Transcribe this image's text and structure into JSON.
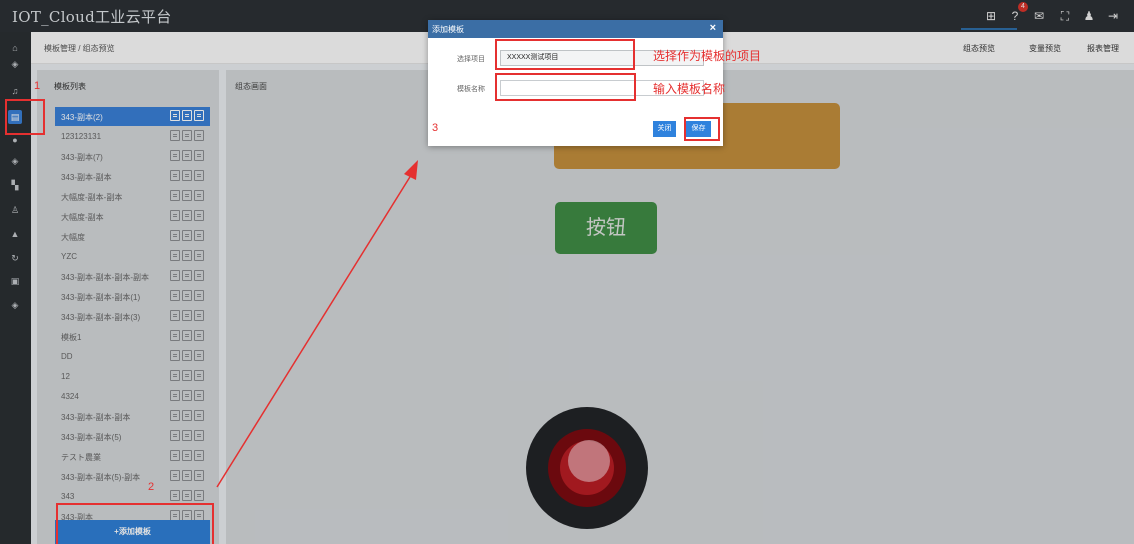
{
  "app": {
    "title": "IOT_Cloud工业云平台"
  },
  "topbar": {
    "icons": [
      "apps-icon",
      "help-icon",
      "mail-icon",
      "fullscreen-icon",
      "user-icon",
      "logout-icon"
    ],
    "notification_count": "4"
  },
  "breadcrumb": "模板管理 / 组态预览",
  "right_tabs": [
    "组态预览",
    "变量预览",
    "报表管理"
  ],
  "sidebar": {
    "icons": [
      "home-icon",
      "layers-icon",
      "bell-icon",
      "template-icon",
      "car-icon",
      "layers2-icon",
      "grid-icon",
      "user-icon",
      "cap-icon",
      "refresh-icon",
      "list-icon",
      "layers3-icon"
    ]
  },
  "left_panel": {
    "title": "模板列表",
    "items": [
      "343-副本(2)",
      "123123131",
      "343-副本(7)",
      "343-副本-副本",
      "大幅度-副本-副本",
      "大幅度-副本",
      "大幅度",
      "YZC",
      "343-副本-副本-副本-副本",
      "343-副本-副本-副本(1)",
      "343-副本-副本-副本(3)",
      "模板1",
      "DD",
      "12",
      "4324",
      "343-副本-副本-副本",
      "343-副本-副本(5)",
      "テスト農業",
      "343-副本-副本(5)-副本",
      "343",
      "343-副本"
    ],
    "add_button": "+添加模板"
  },
  "canvas": {
    "title": "组态画面",
    "button_label": "按钮"
  },
  "modal": {
    "title": "添加模板",
    "close_icon": "×",
    "project_label": "选择项目",
    "project_value": "XXXXX测试项目",
    "name_label": "模板名称",
    "name_value": "",
    "close_button": "关闭",
    "save_button": "保存"
  },
  "annotations": {
    "step1": "1",
    "step2": "2",
    "step3": "3",
    "hint_project": "选择作为模板的项目",
    "hint_name": "输入模板名称",
    "color": "#e53030"
  },
  "colors": {
    "accent": "#3a7fd5",
    "modal_header": "#3b6ea5",
    "topbar": "#2c3035"
  }
}
